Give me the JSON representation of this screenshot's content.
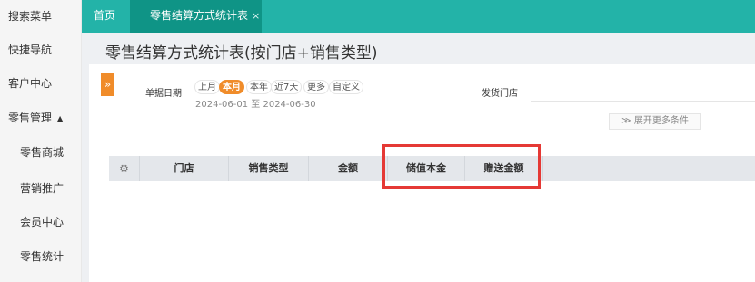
{
  "sidebar": {
    "items": [
      {
        "label": "搜索菜单"
      },
      {
        "label": "快捷导航"
      },
      {
        "label": "客户中心"
      },
      {
        "label": "零售管理",
        "caret": "▲"
      },
      {
        "label": "零售商城"
      },
      {
        "label": "营销推广"
      },
      {
        "label": "会员中心"
      },
      {
        "label": "零售统计"
      }
    ]
  },
  "tabs": {
    "home": "首页",
    "active": "零售结算方式统计表",
    "close": "×"
  },
  "page": {
    "title": "零售结算方式统计表(按门店+销售类型)"
  },
  "filters": {
    "expand_icon": "»",
    "date_label": "单据日期",
    "date_chips": [
      "上月",
      "本月",
      "本年",
      "近7天",
      "更多",
      "自定义"
    ],
    "selected_chip": "本月",
    "date_range": "2024-06-01 至 2024-06-30",
    "store_label": "发货门店",
    "store_value": "",
    "more_conditions": "≫ 展开更多条件"
  },
  "table": {
    "settings_icon": "gear-icon",
    "columns": [
      "门店",
      "销售类型",
      "金额",
      "储值本金",
      "赠送金额"
    ],
    "rows": []
  },
  "colors": {
    "header_teal": "#23b3a8",
    "active_tab": "#0f9486",
    "accent_orange": "#f08c2a",
    "highlight_red": "#e53935"
  }
}
